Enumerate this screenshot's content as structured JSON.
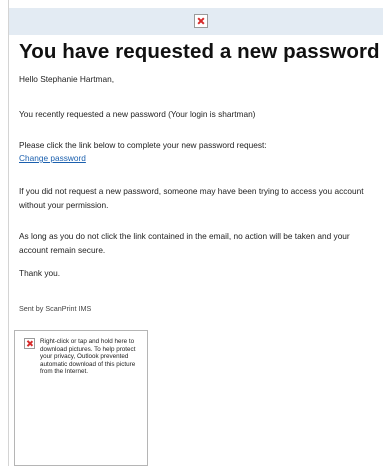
{
  "email": {
    "header_icon": "broken-image-icon",
    "title": "You have requested a new password",
    "greeting": "Hello Stephanie Hartman,",
    "requested_text": "You recently requested a new password (Your login is shartman)",
    "instructions": "Please click the link below to complete your new password request:",
    "change_link": "Change password",
    "warning_1": "If you did not request a new password, someone may have been trying to access you account without your permission.",
    "warning_2": "As long as you do not click the link contained in the email, no action will be taken and your account remain secure.",
    "thanks": "Thank you.",
    "sent_by": "Sent by ScanPrint IMS"
  },
  "image_placeholder": {
    "icon": "broken-image-icon",
    "text": "Right-click or tap and hold here to download pictures. To help protect your privacy, Outlook prevented automatic download of this picture from the Internet."
  },
  "colors": {
    "header_band": "#e3ebf3",
    "link": "#1a5fae",
    "icon_x": "#d62b2b"
  }
}
